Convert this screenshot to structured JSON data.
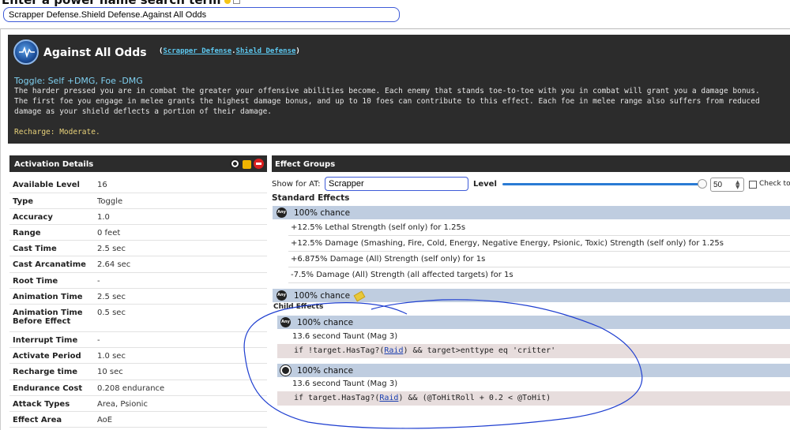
{
  "page": {
    "title": "Enter a power name search term"
  },
  "search": {
    "value": "Scrapper Defense.Shield Defense.Against All Odds"
  },
  "power": {
    "name": "Against All Odds",
    "link_paren_open": "(",
    "link1": "Scrapper Defense",
    "link_dot": ".",
    "link2": "Shield Defense",
    "link_paren_close": ")",
    "subtitle": "Toggle: Self +DMG, Foe -DMG",
    "description": "The harder pressed you are in combat the greater your offensive abilities become. Each enemy that stands toe-to-toe with you in combat will grant you a damage bonus. The first foe you engage in melee grants the highest damage bonus, and up to 10 foes can contribute to this effect. Each foe in melee range also suffers from reduced damage as your shield deflects a portion of their damage.",
    "recharge": "Recharge: Moderate."
  },
  "activation": {
    "header": "Activation Details",
    "rows": [
      {
        "label": "Available Level",
        "value": "16"
      },
      {
        "label": "Type",
        "value": "Toggle"
      },
      {
        "label": "Accuracy",
        "value": "1.0"
      },
      {
        "label": "Range",
        "value": "0 feet"
      },
      {
        "label": "Cast Time",
        "value": "2.5 sec"
      },
      {
        "label": "Cast Arcanatime",
        "value": "2.64 sec"
      },
      {
        "label": "Root Time",
        "value": "-"
      },
      {
        "label": "Animation Time",
        "value": "2.5 sec"
      },
      {
        "label": "Animation Time Before Effect",
        "value": "0.5 sec"
      },
      {
        "label": "Interrupt Time",
        "value": "-"
      },
      {
        "label": "Activate Period",
        "value": "1.0 sec"
      },
      {
        "label": "Recharge time",
        "value": "10 sec"
      },
      {
        "label": "Endurance Cost",
        "value": "0.208 endurance"
      },
      {
        "label": "Attack Types",
        "value": "Area, Psionic"
      },
      {
        "label": "Effect Area",
        "value": "AoE"
      }
    ]
  },
  "effects": {
    "header": "Effect Groups",
    "show_for_label": "Show for AT:",
    "at_value": "Scrapper",
    "level_label": "Level",
    "level_value": "50",
    "level_fraction": 0.98,
    "check_label": "Check to",
    "standard_title": "Standard Effects",
    "group1": {
      "badge": "Any",
      "chance": "100% chance",
      "items": [
        "+12.5% Lethal Strength (self only) for 1.25s",
        "+12.5% Damage (Smashing, Fire, Cold, Energy, Negative Energy, Psionic, Toxic) Strength (self only) for 1.25s",
        "+6.875% Damage (All) Strength (self only) for 1s",
        "-7.5% Damage (All) Strength (all affected targets) for 1s"
      ]
    },
    "group2": {
      "badge": "Any",
      "chance": "100% chance"
    },
    "child_title": "Child Effects",
    "child1": {
      "badge": "Any",
      "chance": "100% chance",
      "effect": "13.6 second Taunt (Mag 3)",
      "cond_pre": "if !target.HasTag?(",
      "cond_link": "Raid",
      "cond_post": ") && target>enttype eq 'critter'"
    },
    "child2": {
      "chance": "100% chance",
      "effect": "13.6 second Taunt (Mag 3)",
      "cond_pre": "if target.HasTag?(",
      "cond_link": "Raid",
      "cond_post": ") && (@ToHitRoll + 0.2 < @ToHit)"
    }
  },
  "colors": {
    "panel_dark": "#2c2c2c",
    "group_blue": "#bfcde0",
    "cond_bg": "#e7dddd",
    "annotation": "#1f3fd0"
  }
}
